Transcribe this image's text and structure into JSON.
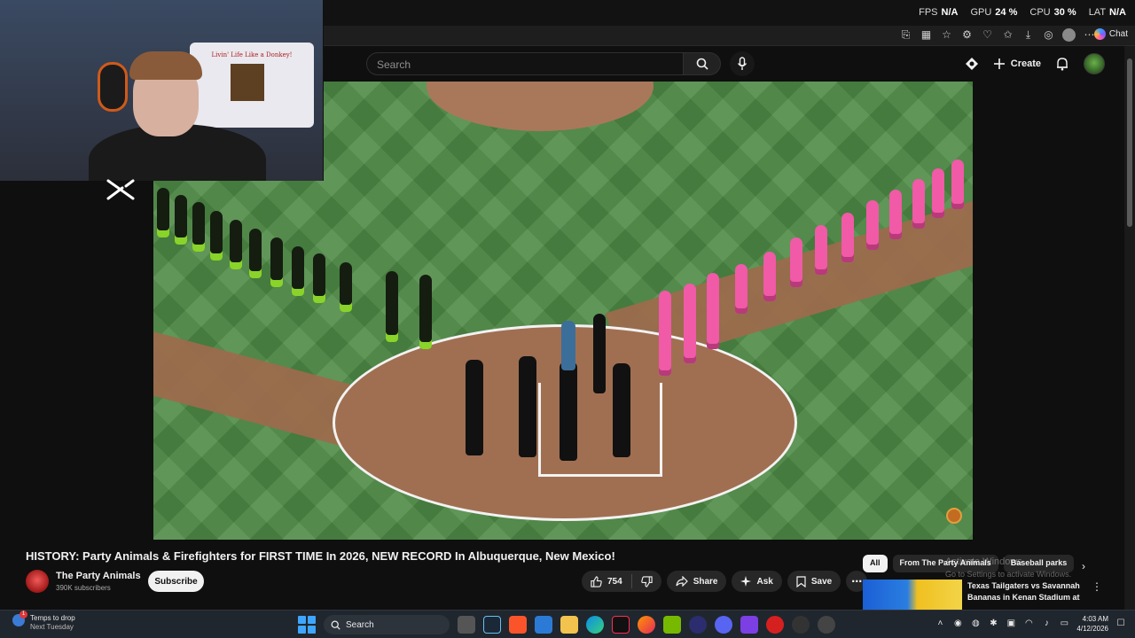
{
  "perf": [
    {
      "key": "FPS",
      "value": "N/A"
    },
    {
      "key": "GPU",
      "value": "24 %"
    },
    {
      "key": "CPU",
      "value": "30 %"
    },
    {
      "key": "LAT",
      "value": "N/A"
    }
  ],
  "browser": {
    "chat_label": "Chat"
  },
  "masthead": {
    "search_placeholder": "Search",
    "create_label": "Create"
  },
  "video": {
    "title": "HISTORY: Party Animals & Firefighters for FIRST TIME In 2026, NEW RECORD In Albuquerque, New Mexico!",
    "channel": "The Party Animals",
    "subscribers": "390K subscribers",
    "subscribe_label": "Subscribe",
    "likes": "754",
    "share_label": "Share",
    "ask_label": "Ask",
    "save_label": "Save"
  },
  "webcam": {
    "shirt_text": "Livin' Life Like a Donkey!"
  },
  "recommendations": {
    "chips": [
      "All",
      "From The Party Animals",
      "Baseball parks"
    ],
    "items": [
      {
        "title": "Texas Tailgaters vs Savannah Bananas in Kenan Stadium at ..."
      }
    ]
  },
  "windows_watermark": {
    "line1": "Activate Windows",
    "line2": "Go to Settings to activate Windows."
  },
  "taskbar": {
    "weather_title": "Temps to drop",
    "weather_sub": "Next Tuesday",
    "weather_badge": "1",
    "search_label": "Search",
    "time": "4:03 AM",
    "date": "4/12/2026"
  },
  "colors": {
    "accent_blue": "#3ea6ff",
    "yt_bg": "#0f0f0f",
    "pink_uniform": "#f05aa7",
    "green_uniform": "#8ad32a"
  }
}
